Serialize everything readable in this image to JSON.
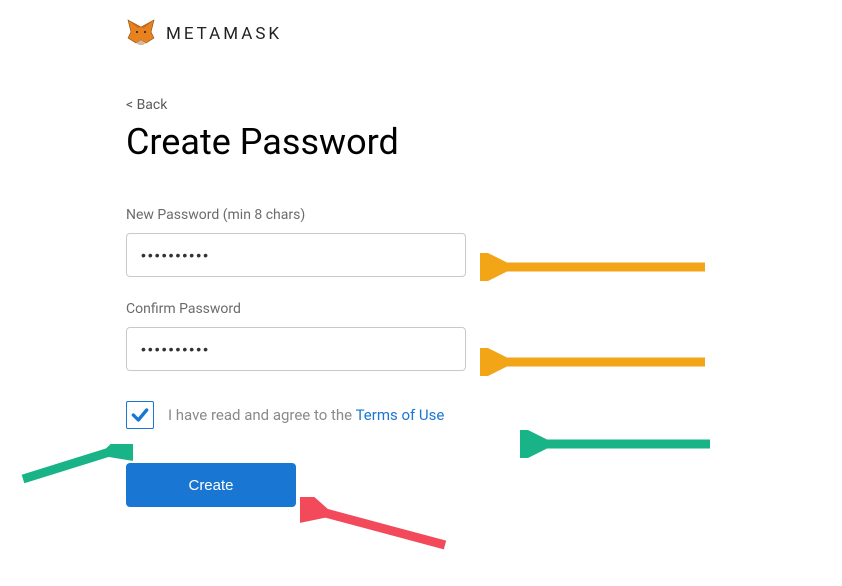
{
  "brand": {
    "name": "METAMASK"
  },
  "nav": {
    "back": "< Back"
  },
  "page": {
    "title": "Create Password"
  },
  "fields": {
    "newPassword": {
      "label": "New Password (min 8 chars)",
      "value": "••••••••••"
    },
    "confirmPassword": {
      "label": "Confirm Password",
      "value": "••••••••••"
    }
  },
  "agreement": {
    "checked": true,
    "prefix": "I have read and agree to the ",
    "tosLabel": "Terms of Use"
  },
  "actions": {
    "create": "Create"
  },
  "colors": {
    "primary": "#1976d2",
    "arrowOrange": "#f2a516",
    "arrowGreen": "#18b387",
    "arrowRed": "#f24a5b"
  }
}
